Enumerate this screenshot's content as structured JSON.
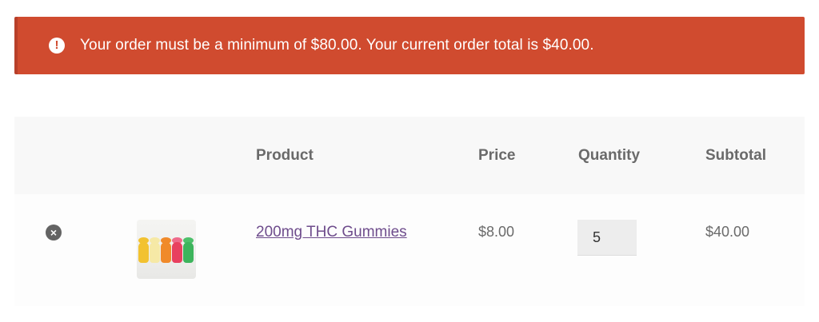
{
  "notice": {
    "icon": "exclamation-icon",
    "message": "Your order must be a minimum of $80.00. Your current order total is $40.00.",
    "color": "#d04b2f"
  },
  "cart": {
    "headers": {
      "product": "Product",
      "price": "Price",
      "quantity": "Quantity",
      "subtotal": "Subtotal"
    },
    "items": [
      {
        "remove_icon": "remove-icon",
        "thumbnail": "gummy-bears-image",
        "name": "200mg THC Gummies",
        "price": "$8.00",
        "quantity": "5",
        "subtotal": "$40.00"
      }
    ]
  },
  "colors": {
    "link": "#6e4c8c",
    "header_bg": "#f8f8f8"
  }
}
